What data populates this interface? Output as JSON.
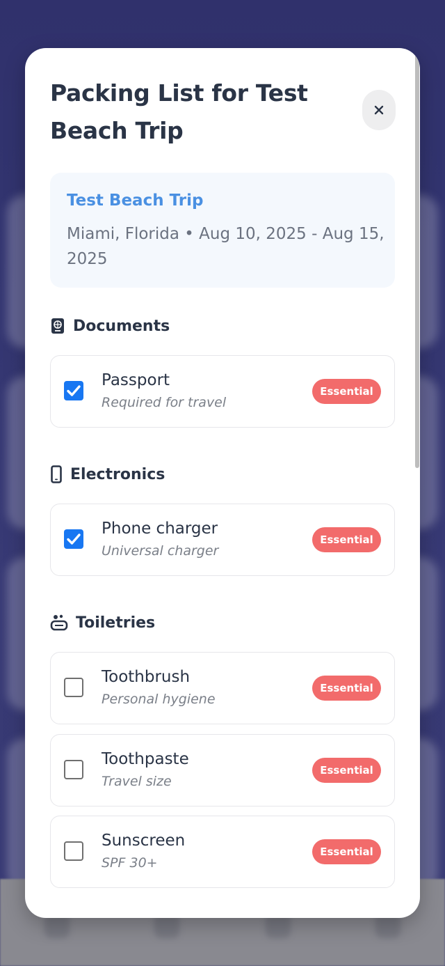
{
  "modal": {
    "title": "Packing List for Test Beach Trip",
    "close_icon": "close-icon"
  },
  "trip": {
    "name": "Test Beach Trip",
    "meta": "Miami, Florida • Aug 10, 2025 - Aug 15, 2025"
  },
  "categories": [
    {
      "label": "Documents",
      "icon": "passport-icon",
      "items": [
        {
          "name": "Passport",
          "note": "Required for travel",
          "checked": true,
          "badge": "Essential"
        }
      ]
    },
    {
      "label": "Electronics",
      "icon": "phone-icon",
      "items": [
        {
          "name": "Phone charger",
          "note": "Universal charger",
          "checked": true,
          "badge": "Essential"
        }
      ]
    },
    {
      "label": "Toiletries",
      "icon": "soap-icon",
      "items": [
        {
          "name": "Toothbrush",
          "note": "Personal hygiene",
          "checked": false,
          "badge": "Essential"
        },
        {
          "name": "Toothpaste",
          "note": "Travel size",
          "checked": false,
          "badge": "Essential"
        },
        {
          "name": "Sunscreen",
          "note": "SPF 30+",
          "checked": false,
          "badge": "Essential"
        }
      ]
    }
  ],
  "colors": {
    "accent": "#4a90e2",
    "checkbox": "#1877f2",
    "badge": "#f26b6b",
    "text": "#2a3446"
  }
}
